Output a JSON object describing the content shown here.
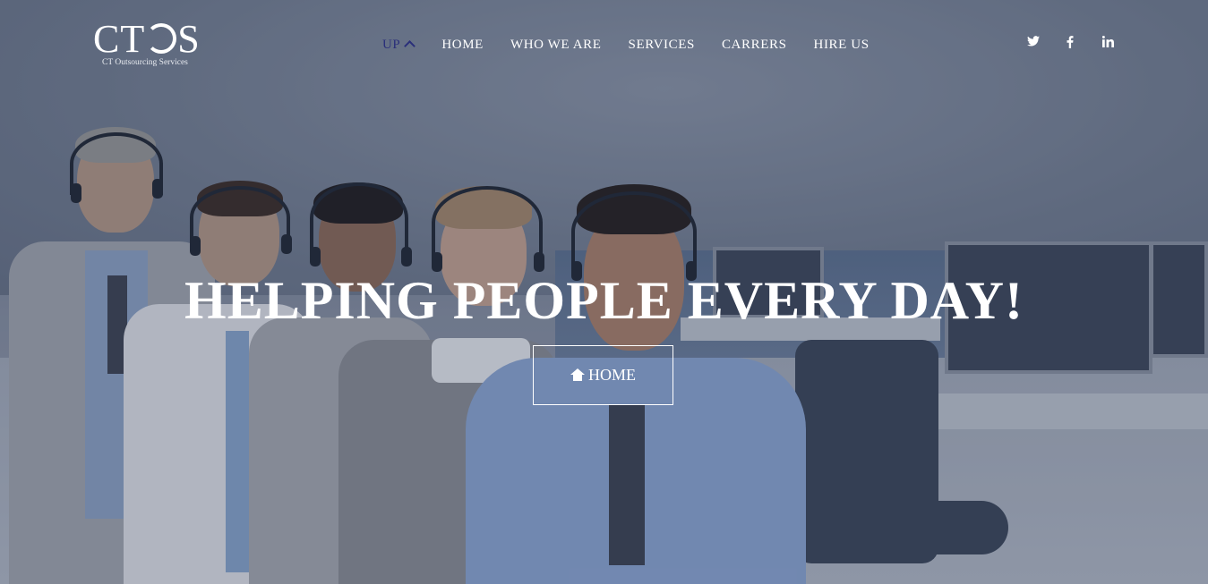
{
  "logo": {
    "mark_left": "CT",
    "mark_right": "S",
    "subtitle": "CT Outsourcing Services"
  },
  "nav": {
    "items": [
      {
        "label": "UP",
        "active": true
      },
      {
        "label": "HOME"
      },
      {
        "label": "WHO WE ARE"
      },
      {
        "label": "SERVICES"
      },
      {
        "label": "CARRERS"
      },
      {
        "label": "HIRE US"
      }
    ],
    "active_color": "#2a2f7a"
  },
  "social": {
    "twitter": "t",
    "facebook": "f",
    "linkedin": "in"
  },
  "hero": {
    "title": "HELPING PEOPLE EVERY DAY!",
    "button_label": "HOME"
  },
  "icons": {
    "twitter": "twitter-icon",
    "facebook": "facebook-icon",
    "linkedin": "linkedin-icon",
    "home": "home-icon",
    "up": "chevron-up-icon"
  }
}
